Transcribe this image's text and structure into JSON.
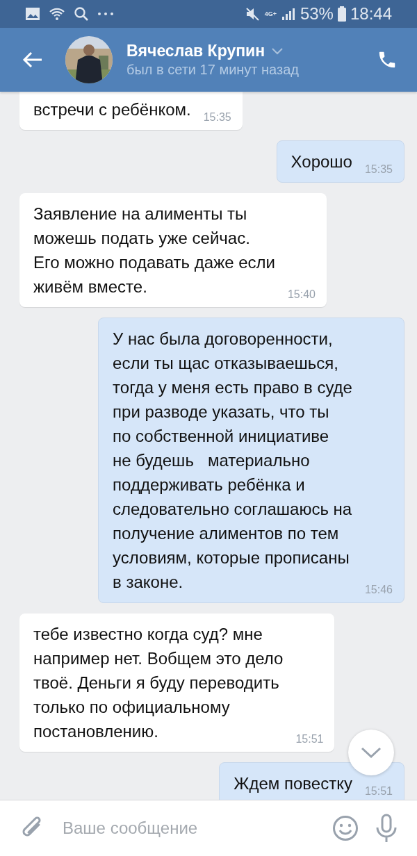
{
  "status_bar": {
    "network": "4G+",
    "battery": "53%",
    "time": "18:44"
  },
  "header": {
    "name": "Вячеслав Крупин",
    "status": "был в сети 17 минут назад"
  },
  "messages": [
    {
      "kind": "incoming",
      "text": "встречи с ребёнком.",
      "time": "15:35"
    },
    {
      "kind": "outgoing",
      "text": "Хорошо",
      "time": "15:35"
    },
    {
      "kind": "incoming",
      "text": "Заявление на алименты ты\nможешь подать уже сейчас.\nЕго можно подавать даже если\nживём вместе.",
      "time": "15:40"
    },
    {
      "kind": "outgoing",
      "text": "У нас была договоренности,\nесли ты щас отказываешься,\nтогда у меня есть право в суде\nпри разводе указать, что ты\nпо собственной инициативе\nне будешь   материально\nподдерживать ребёнка и\nследовательно соглашаюсь на\nполучение алиментов по тем\nусловиям, которые прописаны\nв законе.",
      "time": "15:46"
    },
    {
      "kind": "incoming",
      "text": "тебе известно когда суд? мне\nнапример нет. Вобщем это дело\nтвоё. Деньги я буду переводить\nтолько по официальному\nпостановлению.",
      "time": "15:51"
    },
    {
      "kind": "outgoing",
      "text": "Ждем повестку",
      "time": "15:51"
    }
  ],
  "composer": {
    "placeholder": "Ваше сообщение"
  }
}
